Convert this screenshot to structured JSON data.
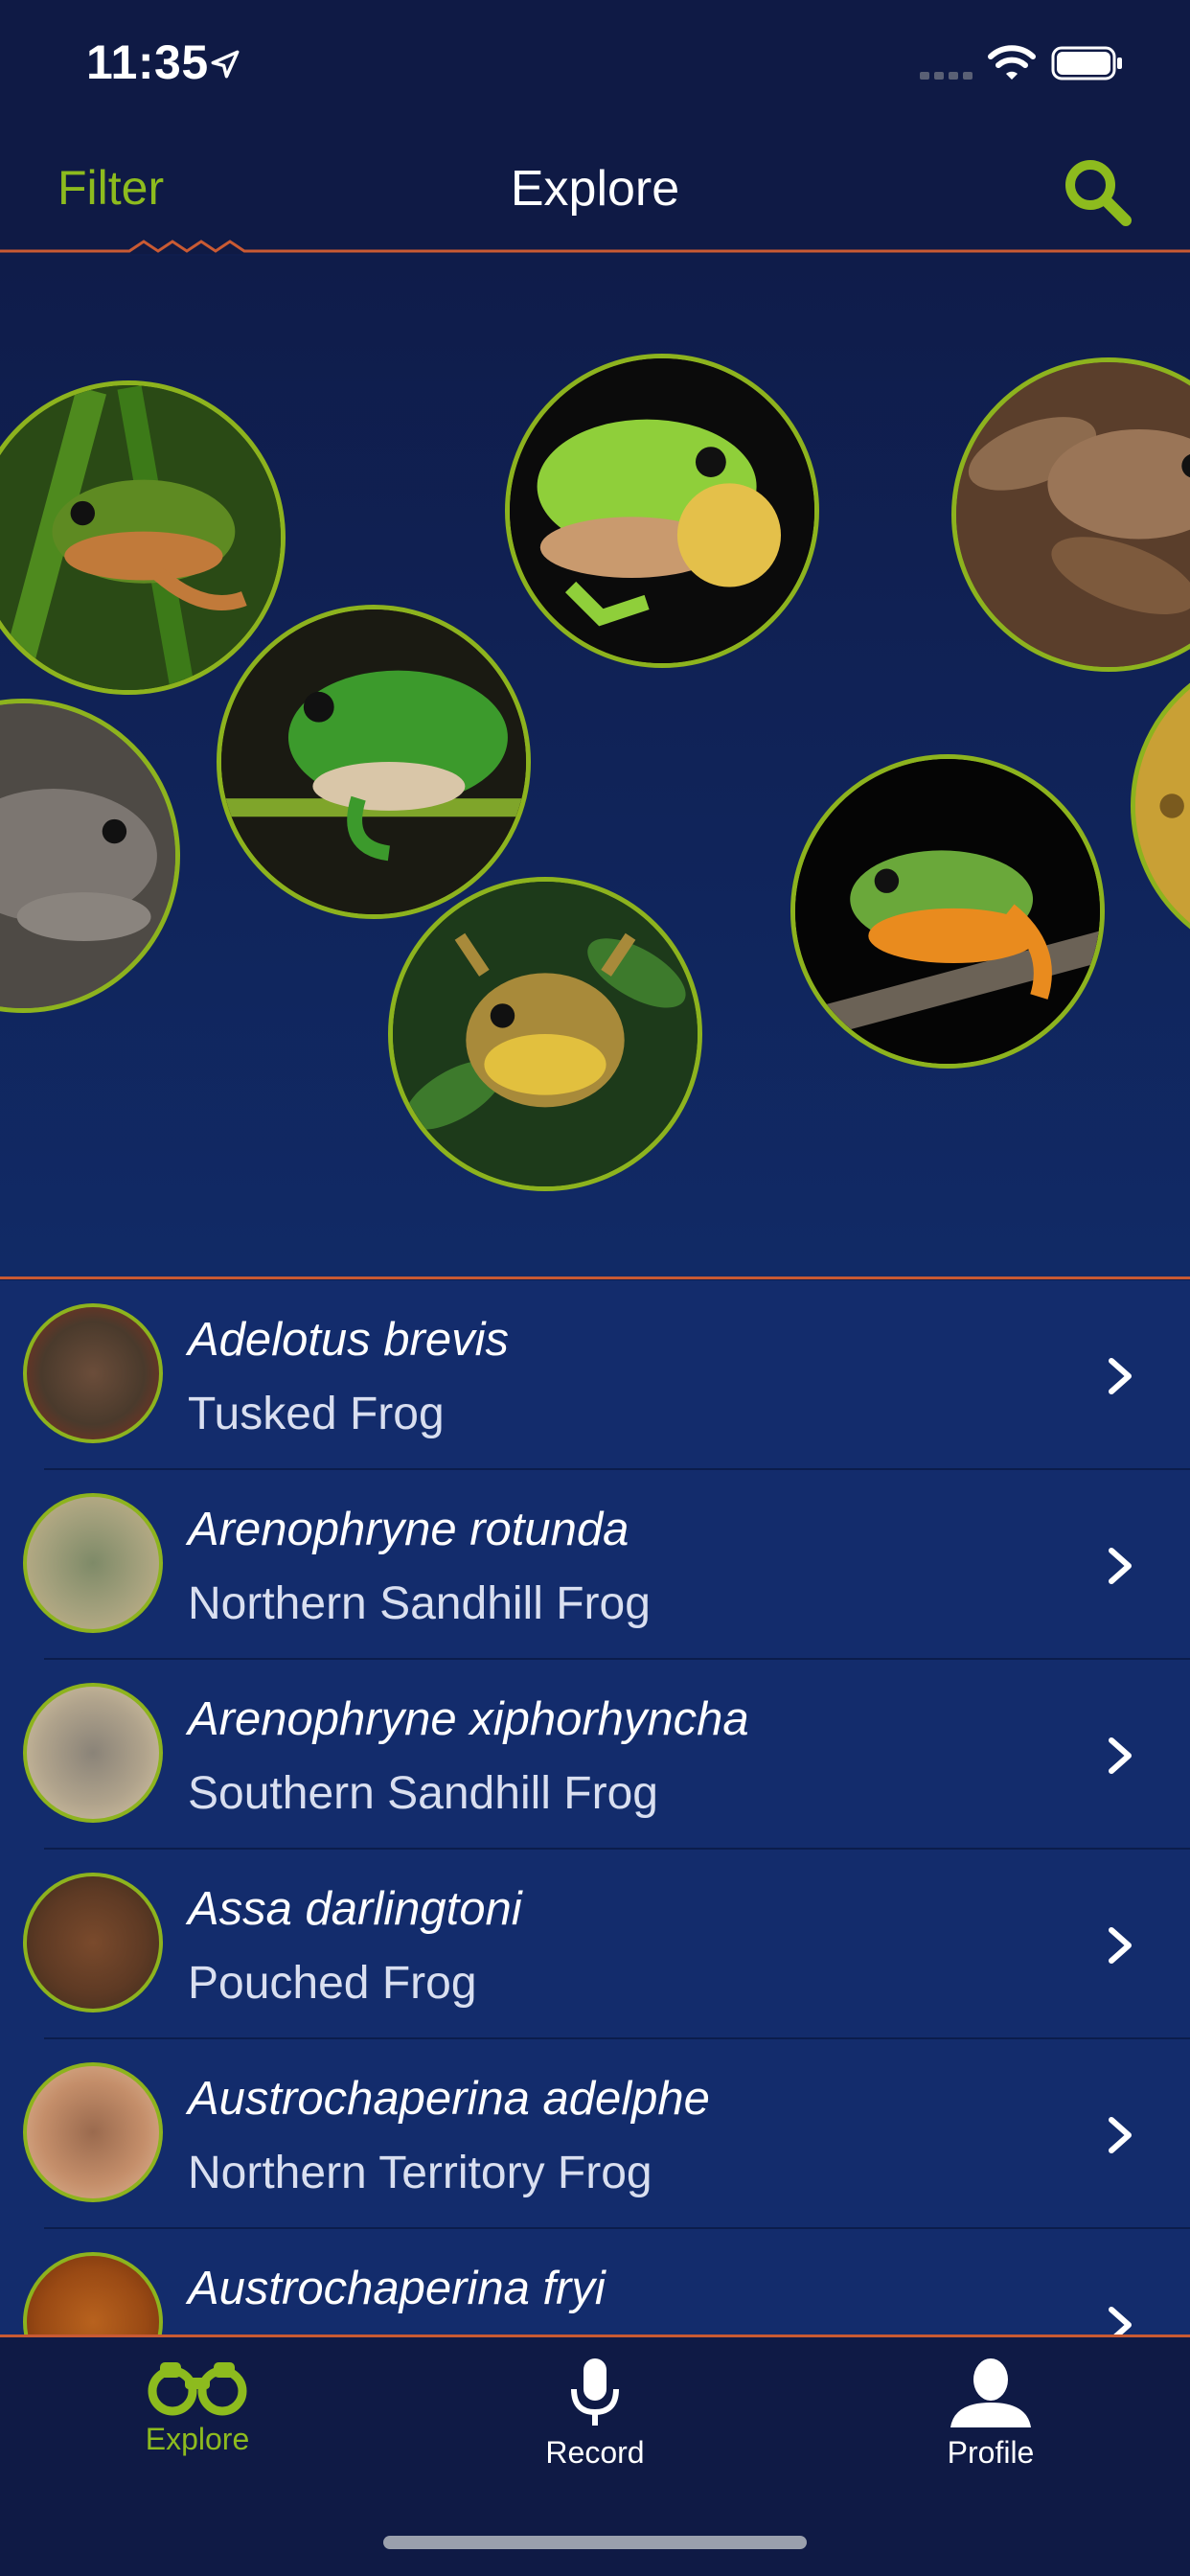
{
  "status_bar": {
    "time": "11:35"
  },
  "nav": {
    "filter_label": "Filter",
    "title": "Explore"
  },
  "colors": {
    "accent_green": "#8dbb1e",
    "accent_orange": "#c95a33",
    "nav_background": "#0f1a45",
    "list_background": "#132c6c"
  },
  "species": [
    {
      "scientific_name": "Adelotus brevis",
      "common_name": "Tusked Frog"
    },
    {
      "scientific_name": "Arenophryne rotunda",
      "common_name": "Northern Sandhill Frog"
    },
    {
      "scientific_name": "Arenophryne xiphorhyncha",
      "common_name": "Southern Sandhill Frog"
    },
    {
      "scientific_name": "Assa darlingtoni",
      "common_name": "Pouched Frog"
    },
    {
      "scientific_name": "Austrochaperina adelphe",
      "common_name": "Northern Territory Frog"
    },
    {
      "scientific_name": "Austrochaperina fryi",
      "common_name": ""
    }
  ],
  "tabs": [
    {
      "label": "Explore",
      "icon": "binoculars-icon",
      "active": true
    },
    {
      "label": "Record",
      "icon": "microphone-icon",
      "active": false
    },
    {
      "label": "Profile",
      "icon": "person-icon",
      "active": false
    }
  ]
}
